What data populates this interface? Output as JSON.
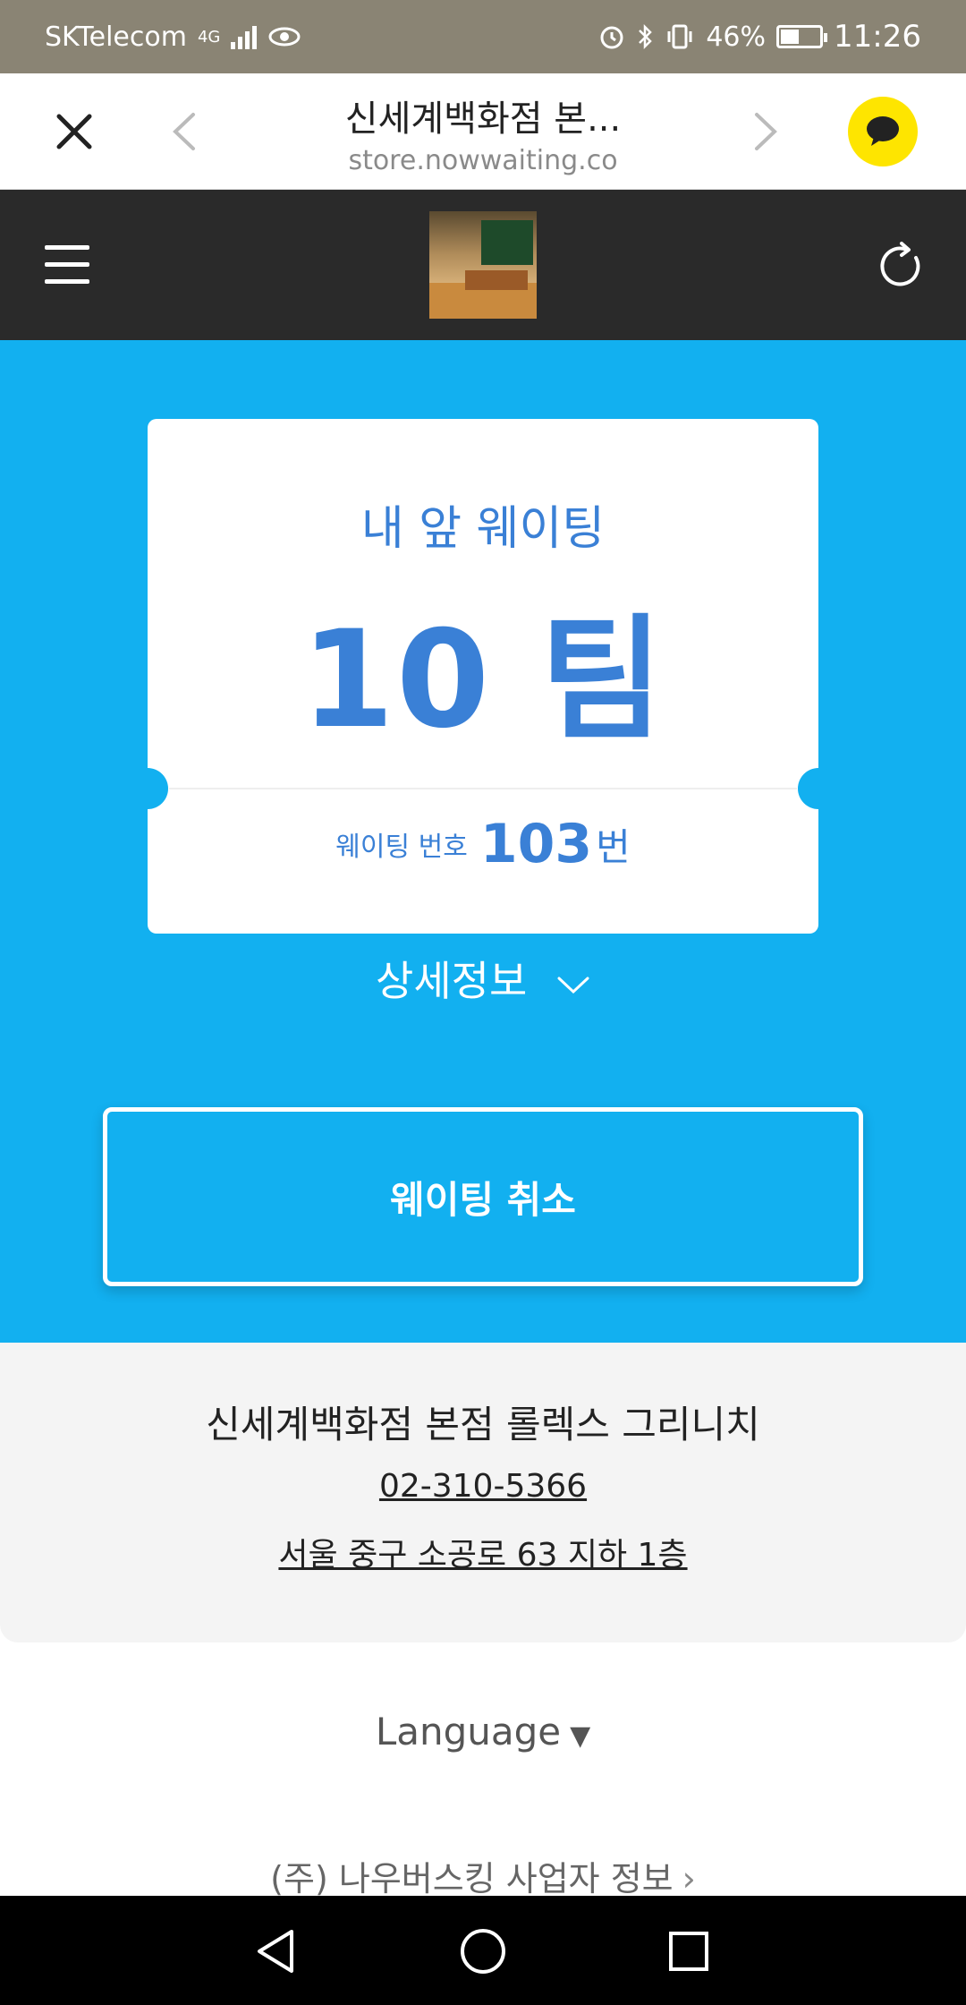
{
  "status_bar": {
    "carrier": "SKTelecom",
    "network": "4G",
    "battery": "46%",
    "battery_level": 0.46,
    "time": "11:26"
  },
  "browser": {
    "title": "신세계백화점 본...",
    "url": "store.nowwaiting.co"
  },
  "waiting": {
    "ahead_label": "내 앞 웨이팅",
    "ahead_count": "10 팀",
    "number_label": "웨이팅 번호",
    "number_value": "103",
    "number_unit": "번",
    "details_label": "상세정보",
    "cancel_label": "웨이팅 취소"
  },
  "store": {
    "name": "신세계백화점 본점 롤렉스 그리니치",
    "phone": "02-310-5366",
    "address": "서울 중구 소공로 63 지하 1층"
  },
  "footer": {
    "language_label": "Language",
    "language_caret": "▼",
    "company_label": "(주) 나우버스킹 사업자 정보",
    "company_chevron": "›"
  },
  "colors": {
    "primary_blue": "#12b0f0",
    "accent_text": "#3a80d6",
    "kakao_yellow": "#fee500",
    "nav_dark": "#2a2a2a"
  },
  "icons": [
    "close-icon",
    "back-arrow-icon",
    "forward-arrow-icon",
    "kakaotalk-icon",
    "menu-icon",
    "refresh-icon",
    "chevron-down-icon",
    "android-back-icon",
    "android-home-icon",
    "android-recent-icon"
  ]
}
